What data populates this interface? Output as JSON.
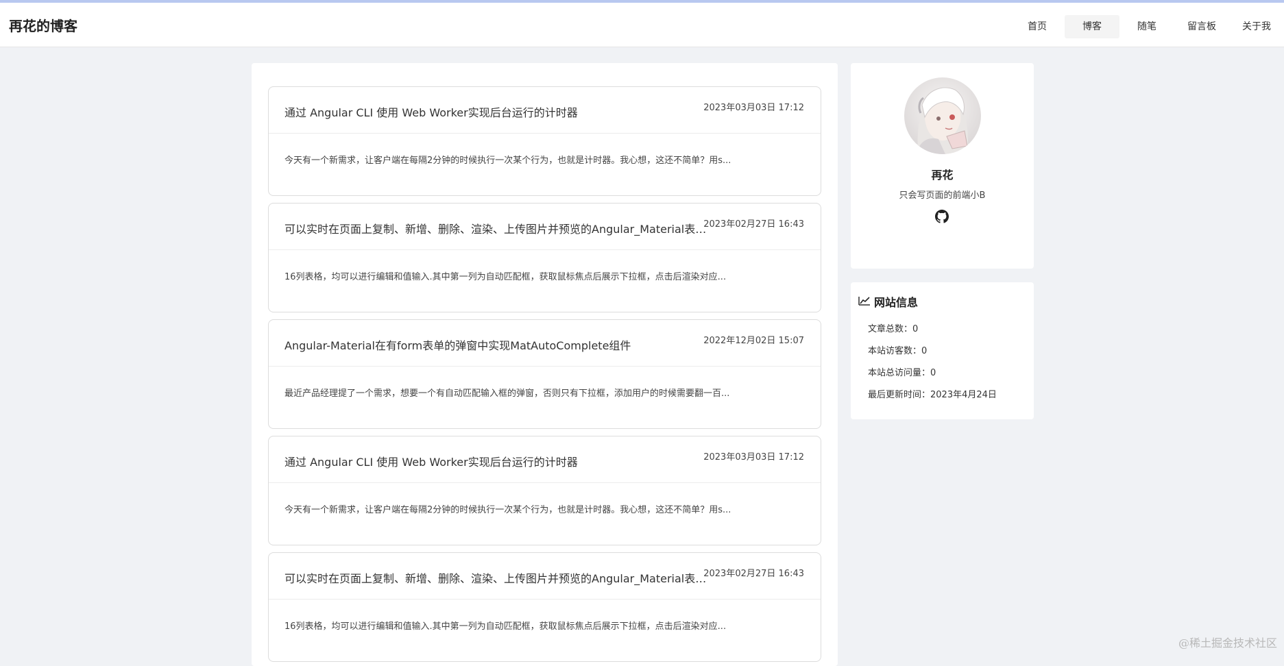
{
  "header": {
    "site_title": "再花的博客",
    "nav": [
      {
        "label": "首页"
      },
      {
        "label": "博客"
      },
      {
        "label": "随笔"
      },
      {
        "label": "留言板"
      },
      {
        "label": "关于我"
      }
    ],
    "active_nav": "博客"
  },
  "posts": [
    {
      "title": "通过 Angular CLI 使用 Web Worker实现后台运行的计时器",
      "date": "2023年03月03日 17:12",
      "summary": "今天有一个新需求，让客户端在每隔2分钟的时候执行一次某个行为，也就是计时器。我心想，这还不简单？用s..."
    },
    {
      "title": "可以实时在页面上复制、新增、删除、渲染、上传图片并预览的Angular_Material表格...",
      "date": "2023年02月27日 16:43",
      "summary": "16列表格，均可以进行编辑和值输入.其中第一列为自动匹配框，获取鼠标焦点后展示下拉框，点击后渲染对应..."
    },
    {
      "title": "Angular-Material在有form表单的弹窗中实现MatAutoComplete组件",
      "date": "2022年12月02日 15:07",
      "summary": "最近产品经理提了一个需求，想要一个有自动匹配输入框的弹窗，否则只有下拉框，添加用户的时候需要翻一百..."
    },
    {
      "title": "通过 Angular CLI 使用 Web Worker实现后台运行的计时器",
      "date": "2023年03月03日 17:12",
      "summary": "今天有一个新需求，让客户端在每隔2分钟的时候执行一次某个行为，也就是计时器。我心想，这还不简单？用s..."
    },
    {
      "title": "可以实时在页面上复制、新增、删除、渲染、上传图片并预览的Angular_Material表格...",
      "date": "2023年02月27日 16:43",
      "summary": "16列表格，均可以进行编辑和值输入.其中第一列为自动匹配框，获取鼠标焦点后展示下拉框，点击后渲染对应..."
    }
  ],
  "profile": {
    "name": "再花",
    "bio": "只会写页面的前端小B",
    "link_icon": "github-icon"
  },
  "site_info": {
    "title": "网站信息",
    "icon": "line-chart-icon",
    "stats": [
      {
        "text": "文章总数：0"
      },
      {
        "text": "本站访客数：0"
      },
      {
        "text": "本站总访问量：0"
      },
      {
        "text": "最后更新时间：2023年4月24日"
      }
    ]
  },
  "watermark": "@稀土掘金技术社区"
}
